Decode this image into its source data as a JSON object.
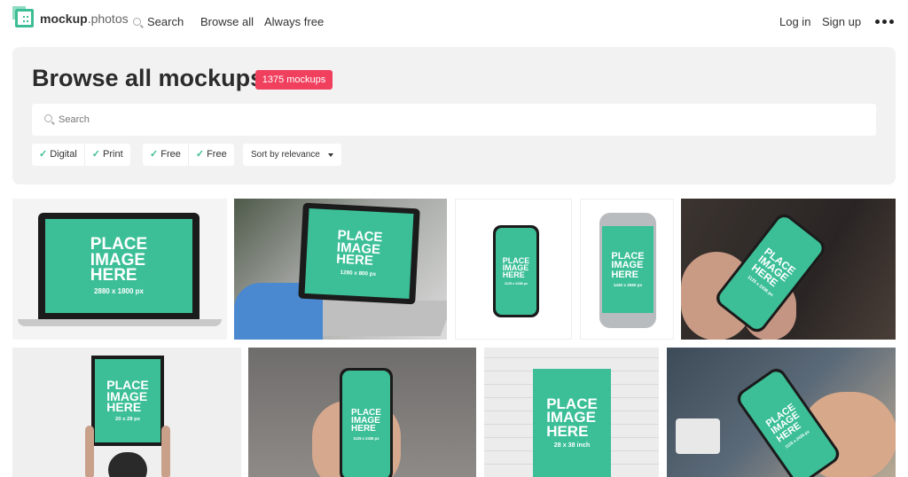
{
  "nav": {
    "logo_bold": "mockup",
    "logo_light": ".photos",
    "search": "Search",
    "browse_all": "Browse all",
    "always_free": "Always free",
    "login": "Log in",
    "signup": "Sign up",
    "more_icon": "three-dots-icon"
  },
  "header": {
    "title": "Browse all mockups",
    "count_badge": "1375 mockups",
    "search_placeholder": "Search",
    "filters": [
      {
        "label": "Digital",
        "checked": true
      },
      {
        "label": "Print",
        "checked": true
      },
      {
        "label": "Free",
        "checked": true
      },
      {
        "label": "Free",
        "checked": true
      }
    ],
    "sort": "Sort by relevance"
  },
  "colors": {
    "accent": "#3dbd95",
    "badge": "#f0405e",
    "screen": "#3cbf96"
  },
  "mockups": [
    {
      "text": "PLACE IMAGE HERE",
      "dims": "2880 x 1800 px"
    },
    {
      "text": "PLACE IMAGE HERE",
      "dims": "1280 x 800 px"
    },
    {
      "text": "PLACE IMAGE HERE",
      "dims": "1125 x 2436 px"
    },
    {
      "text": "PLACE IMAGE HERE",
      "dims": "1440 x 2560 px"
    },
    {
      "text": "PLACE IMAGE HERE",
      "dims": "1125 x 2436 px"
    },
    {
      "text": "PLACE IMAGE HERE",
      "dims": "20 x 28 px"
    },
    {
      "text": "PLACE IMAGE HERE",
      "dims": "1125 x 2436 px"
    },
    {
      "text": "PLACE IMAGE HERE",
      "dims": "28 x 38 inch"
    },
    {
      "text": "PLACE IMAGE HERE",
      "dims": "1125 x 2436 px"
    }
  ]
}
